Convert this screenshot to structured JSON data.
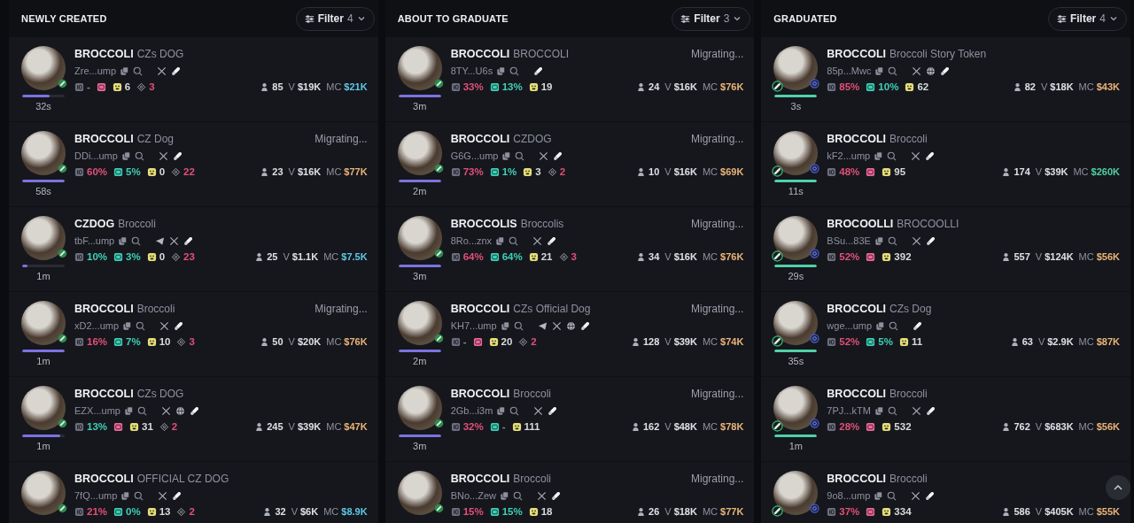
{
  "columns": [
    {
      "title": "NEWLY CREATED",
      "filter": {
        "label": "Filter",
        "count": "4"
      },
      "graduated": false,
      "cards": [
        {
          "symbol": "BROCCOLI",
          "name": "CZs DOG",
          "address": "Zre...ump",
          "links": [
            {
              "kind": "x"
            },
            {
              "kind": "pill"
            }
          ],
          "stats": [
            {
              "kind": "top10",
              "value": "-"
            },
            {
              "kind": "ds"
            },
            {
              "kind": "snipers",
              "value": "6",
              "color": "#d8d9de"
            },
            {
              "kind": "insiders",
              "value": "3",
              "color": "#e0507a"
            }
          ],
          "holders": "85",
          "volume_label": "V",
          "volume": "$19K",
          "mc_label": "MC",
          "mc": {
            "value": "$21K",
            "color": "#5ec8e6"
          },
          "age": "32s",
          "level": 0.65
        },
        {
          "symbol": "BROCCOLI",
          "name": "CZ Dog",
          "status": "Migrating...",
          "address": "DDi...ump",
          "links": [
            {
              "kind": "x"
            },
            {
              "kind": "pill"
            }
          ],
          "stats": [
            {
              "kind": "top10",
              "value": "60%",
              "color": "#e0507a"
            },
            {
              "kind": "dh",
              "value": "5%",
              "color": "#3fcfb8"
            },
            {
              "kind": "snipers",
              "value": "0",
              "color": "#d8d9de"
            },
            {
              "kind": "insiders",
              "value": "22",
              "color": "#e0507a"
            }
          ],
          "holders": "23",
          "volume_label": "V",
          "volume": "$16K",
          "mc_label": "MC",
          "mc": {
            "value": "$77K",
            "color": "#e9b47a"
          },
          "age": "58s",
          "level": 1
        },
        {
          "symbol": "CZDOG",
          "name": "Broccoli",
          "address": "tbF...ump",
          "links": [
            {
              "kind": "telegram"
            },
            {
              "kind": "x"
            },
            {
              "kind": "pill"
            }
          ],
          "stats": [
            {
              "kind": "top10",
              "value": "10%",
              "color": "#3fcfb8"
            },
            {
              "kind": "dh",
              "value": "3%",
              "color": "#3fcfb8"
            },
            {
              "kind": "snipers",
              "value": "0",
              "color": "#d8d9de"
            },
            {
              "kind": "insiders",
              "value": "23",
              "color": "#e0507a"
            }
          ],
          "holders": "25",
          "volume_label": "V",
          "volume": "$1.1K",
          "mc_label": "MC",
          "mc": {
            "value": "$7.5K",
            "color": "#5ec8e6"
          },
          "age": "1m",
          "level": 0.12
        },
        {
          "symbol": "BROCCOLI",
          "name": "Broccoli",
          "status": "Migrating...",
          "address": "xD2...ump",
          "links": [
            {
              "kind": "x"
            },
            {
              "kind": "pill"
            }
          ],
          "stats": [
            {
              "kind": "top10",
              "value": "16%",
              "color": "#e0507a"
            },
            {
              "kind": "dh",
              "value": "7%",
              "color": "#3fcfb8"
            },
            {
              "kind": "snipers",
              "value": "10",
              "color": "#d8d9de"
            },
            {
              "kind": "insiders",
              "value": "3",
              "color": "#e0507a"
            }
          ],
          "holders": "50",
          "volume_label": "V",
          "volume": "$20K",
          "mc_label": "MC",
          "mc": {
            "value": "$76K",
            "color": "#e9b47a"
          },
          "age": "1m",
          "level": 1
        },
        {
          "symbol": "BROCCOLI",
          "name": "CZs DOG",
          "address": "EZX...ump",
          "links": [
            {
              "kind": "x"
            },
            {
              "kind": "web"
            },
            {
              "kind": "pill"
            }
          ],
          "stats": [
            {
              "kind": "top10",
              "value": "13%",
              "color": "#3fcfb8"
            },
            {
              "kind": "ds"
            },
            {
              "kind": "snipers",
              "value": "31",
              "color": "#d8d9de"
            },
            {
              "kind": "insiders",
              "value": "2",
              "color": "#e0507a"
            }
          ],
          "holders": "245",
          "volume_label": "V",
          "volume": "$39K",
          "mc_label": "MC",
          "mc": {
            "value": "$47K",
            "color": "#e9b47a"
          },
          "age": "1m",
          "level": 0.9
        },
        {
          "symbol": "BROCCOLI",
          "name": "OFFICIAL CZ DOG",
          "address": "7fQ...ump",
          "links": [
            {
              "kind": "x"
            },
            {
              "kind": "pill"
            }
          ],
          "stats": [
            {
              "kind": "top10",
              "value": "21%",
              "color": "#e0507a"
            },
            {
              "kind": "dh",
              "value": "0%",
              "color": "#3fcfb8"
            },
            {
              "kind": "snipers",
              "value": "13",
              "color": "#d8d9de"
            },
            {
              "kind": "insiders",
              "value": "2",
              "color": "#e0507a"
            }
          ],
          "holders": "32",
          "volume_label": "V",
          "volume": "$6K",
          "mc_label": "MC",
          "mc": {
            "value": "$8.9K",
            "color": "#5ec8e6"
          }
        }
      ]
    },
    {
      "title": "ABOUT TO GRADUATE",
      "filter": {
        "label": "Filter",
        "count": "3"
      },
      "graduated": false,
      "cards": [
        {
          "symbol": "BROCCOLI",
          "name": "BROCCOLI",
          "status": "Migrating...",
          "address": "8TY...U6s",
          "links": [
            {
              "kind": "pill"
            }
          ],
          "stats": [
            {
              "kind": "top10",
              "value": "33%",
              "color": "#e0507a"
            },
            {
              "kind": "dh",
              "value": "13%",
              "color": "#3fcfb8"
            },
            {
              "kind": "snipers",
              "value": "19",
              "color": "#d8d9de"
            }
          ],
          "holders": "24",
          "volume_label": "V",
          "volume": "$16K",
          "mc_label": "MC",
          "mc": {
            "value": "$76K",
            "color": "#e9b47a"
          },
          "age": "3m",
          "level": 1
        },
        {
          "symbol": "BROCCOLI",
          "name": "CZDOG",
          "status": "Migrating...",
          "address": "G6G...ump",
          "links": [
            {
              "kind": "x"
            },
            {
              "kind": "pill"
            }
          ],
          "stats": [
            {
              "kind": "top10",
              "value": "73%",
              "color": "#e0507a"
            },
            {
              "kind": "dh",
              "value": "1%",
              "color": "#3fcfb8"
            },
            {
              "kind": "snipers",
              "value": "3",
              "color": "#d8d9de"
            },
            {
              "kind": "insiders",
              "value": "2",
              "color": "#e0507a"
            }
          ],
          "holders": "10",
          "volume_label": "V",
          "volume": "$16K",
          "mc_label": "MC",
          "mc": {
            "value": "$69K",
            "color": "#e9b47a"
          },
          "age": "2m",
          "level": 1
        },
        {
          "symbol": "BROCCOLIS",
          "name": "Broccolis",
          "status": "Migrating...",
          "address": "8Ro...znx",
          "links": [
            {
              "kind": "x"
            },
            {
              "kind": "pill"
            }
          ],
          "stats": [
            {
              "kind": "top10",
              "value": "64%",
              "color": "#e0507a"
            },
            {
              "kind": "dh",
              "value": "64%",
              "color": "#3fcfb8"
            },
            {
              "kind": "snipers",
              "value": "21",
              "color": "#d8d9de"
            },
            {
              "kind": "insiders",
              "value": "3",
              "color": "#e0507a"
            }
          ],
          "holders": "34",
          "volume_label": "V",
          "volume": "$16K",
          "mc_label": "MC",
          "mc": {
            "value": "$76K",
            "color": "#e9b47a"
          },
          "age": "3m",
          "level": 1
        },
        {
          "symbol": "BROCCOLI",
          "name": "CZs Official Dog",
          "status": "Migrating...",
          "address": "KH7...ump",
          "links": [
            {
              "kind": "telegram"
            },
            {
              "kind": "x"
            },
            {
              "kind": "web"
            },
            {
              "kind": "pill"
            }
          ],
          "stats": [
            {
              "kind": "top10",
              "value": "-"
            },
            {
              "kind": "ds"
            },
            {
              "kind": "snipers",
              "value": "20",
              "color": "#d8d9de"
            },
            {
              "kind": "insiders",
              "value": "2",
              "color": "#e0507a"
            }
          ],
          "holders": "128",
          "volume_label": "V",
          "volume": "$39K",
          "mc_label": "MC",
          "mc": {
            "value": "$74K",
            "color": "#e9b47a"
          },
          "age": "2m",
          "level": 1
        },
        {
          "symbol": "BROCCOLI",
          "name": "Broccoli",
          "status": "Migrating...",
          "address": "2Gb...i3m",
          "links": [
            {
              "kind": "x"
            },
            {
              "kind": "pill"
            }
          ],
          "stats": [
            {
              "kind": "top10",
              "value": "32%",
              "color": "#e0507a"
            },
            {
              "kind": "dh",
              "value": "-"
            },
            {
              "kind": "snipers",
              "value": "111",
              "color": "#d8d9de"
            }
          ],
          "holders": "162",
          "volume_label": "V",
          "volume": "$48K",
          "mc_label": "MC",
          "mc": {
            "value": "$78K",
            "color": "#e9b47a"
          },
          "age": "3m",
          "level": 1
        },
        {
          "symbol": "BROCCOLI",
          "name": "Broccoli",
          "status": "Migrating...",
          "address": "BNo...Zew",
          "links": [
            {
              "kind": "x"
            },
            {
              "kind": "pill"
            }
          ],
          "stats": [
            {
              "kind": "top10",
              "value": "15%",
              "color": "#e0507a"
            },
            {
              "kind": "dh",
              "value": "15%",
              "color": "#3fcfb8"
            },
            {
              "kind": "snipers",
              "value": "18",
              "color": "#d8d9de"
            }
          ],
          "holders": "26",
          "volume_label": "V",
          "volume": "$18K",
          "mc_label": "MC",
          "mc": {
            "value": "$77K",
            "color": "#e9b47a"
          }
        }
      ]
    },
    {
      "title": "GRADUATED",
      "filter": {
        "label": "Filter",
        "count": "4"
      },
      "graduated": true,
      "cards": [
        {
          "symbol": "BROCCOLI",
          "name": "Broccoli Story Token",
          "address": "85p...Mwc",
          "links": [
            {
              "kind": "x"
            },
            {
              "kind": "web"
            },
            {
              "kind": "pill"
            }
          ],
          "stats": [
            {
              "kind": "top10",
              "value": "85%",
              "color": "#e0507a"
            },
            {
              "kind": "dh",
              "value": "10%",
              "color": "#3fcfb8"
            },
            {
              "kind": "snipers",
              "value": "62",
              "color": "#d8d9de"
            }
          ],
          "holders": "82",
          "volume_label": "V",
          "volume": "$18K",
          "mc_label": "MC",
          "mc": {
            "value": "$43K",
            "color": "#e9b47a"
          },
          "age": "3s",
          "level": 1
        },
        {
          "symbol": "BROCCOLI",
          "name": "Broccoli",
          "address": "kF2...ump",
          "links": [
            {
              "kind": "x"
            },
            {
              "kind": "pill"
            }
          ],
          "stats": [
            {
              "kind": "top10",
              "value": "48%",
              "color": "#e0507a"
            },
            {
              "kind": "ds"
            },
            {
              "kind": "snipers",
              "value": "95",
              "color": "#d8d9de"
            }
          ],
          "holders": "174",
          "volume_label": "V",
          "volume": "$39K",
          "mc_label": "MC",
          "mc": {
            "value": "$260K",
            "color": "#4fd1a0"
          },
          "age": "11s",
          "level": 1
        },
        {
          "symbol": "BROCOOLLI",
          "name": "BROCOOLLI",
          "address": "BSu...83E",
          "links": [
            {
              "kind": "x"
            },
            {
              "kind": "pill"
            }
          ],
          "stats": [
            {
              "kind": "top10",
              "value": "52%",
              "color": "#e0507a"
            },
            {
              "kind": "ds"
            },
            {
              "kind": "snipers",
              "value": "392",
              "color": "#d8d9de"
            }
          ],
          "holders": "557",
          "volume_label": "V",
          "volume": "$124K",
          "mc_label": "MC",
          "mc": {
            "value": "$56K",
            "color": "#e9b47a"
          },
          "age": "29s",
          "level": 1
        },
        {
          "symbol": "BROCCOLI",
          "name": "CZs Dog",
          "address": "wge...ump",
          "links": [
            {
              "kind": "pill"
            }
          ],
          "stats": [
            {
              "kind": "top10",
              "value": "52%",
              "color": "#e0507a"
            },
            {
              "kind": "dh",
              "value": "5%",
              "color": "#3fcfb8"
            },
            {
              "kind": "snipers",
              "value": "11",
              "color": "#d8d9de"
            }
          ],
          "holders": "63",
          "volume_label": "V",
          "volume": "$2.9K",
          "mc_label": "MC",
          "mc": {
            "value": "$87K",
            "color": "#e9b47a"
          },
          "age": "35s",
          "level": 1
        },
        {
          "symbol": "BROCCOLI",
          "name": "Broccoli",
          "address": "7PJ...kTM",
          "links": [
            {
              "kind": "x"
            },
            {
              "kind": "pill"
            }
          ],
          "stats": [
            {
              "kind": "top10",
              "value": "28%",
              "color": "#e0507a"
            },
            {
              "kind": "ds"
            },
            {
              "kind": "snipers",
              "value": "532",
              "color": "#d8d9de"
            }
          ],
          "holders": "762",
          "volume_label": "V",
          "volume": "$683K",
          "mc_label": "MC",
          "mc": {
            "value": "$56K",
            "color": "#e9b47a"
          },
          "age": "1m",
          "level": 1
        },
        {
          "symbol": "BROCCOLI",
          "name": "Broccoli",
          "address": "9o8...ump",
          "links": [
            {
              "kind": "x"
            },
            {
              "kind": "pill"
            }
          ],
          "stats": [
            {
              "kind": "top10",
              "value": "37%",
              "color": "#e0507a"
            },
            {
              "kind": "ds"
            },
            {
              "kind": "snipers",
              "value": "334",
              "color": "#d8d9de"
            }
          ],
          "holders": "586",
          "volume_label": "V",
          "volume": "$405K",
          "mc_label": "MC",
          "mc": {
            "value": "$55K",
            "color": "#e9b47a"
          }
        }
      ]
    }
  ]
}
